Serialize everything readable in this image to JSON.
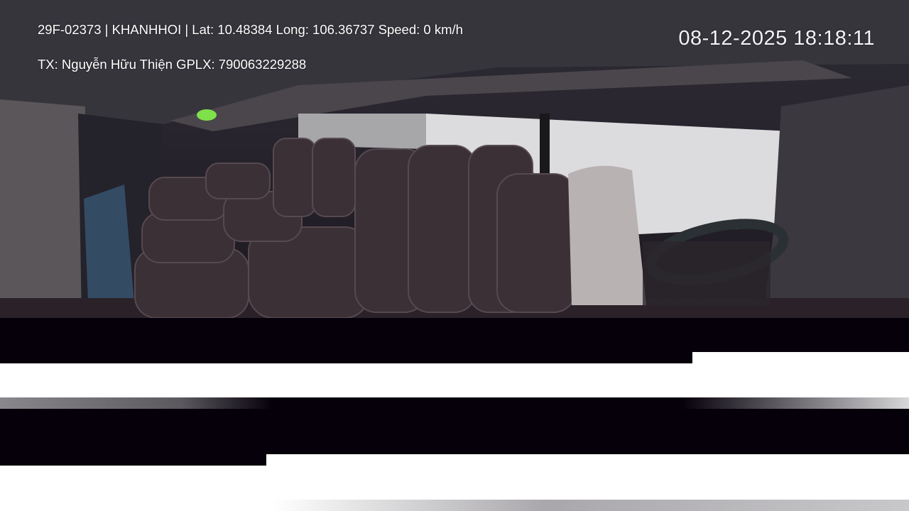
{
  "overlay": {
    "line1": "29F-02373 | KHANHHOI | Lat: 10.48384 Long: 106.36737 Speed: 0 km/h",
    "line2": "TX: Nguyễn Hữu Thiện GPLX: 790063229288",
    "timestamp": "08-12-2025 18:18:11"
  },
  "colors": {
    "glitch_dark": "#05000a",
    "glitch_white": "#ffffff",
    "indicator_green": "#7ee04a"
  }
}
